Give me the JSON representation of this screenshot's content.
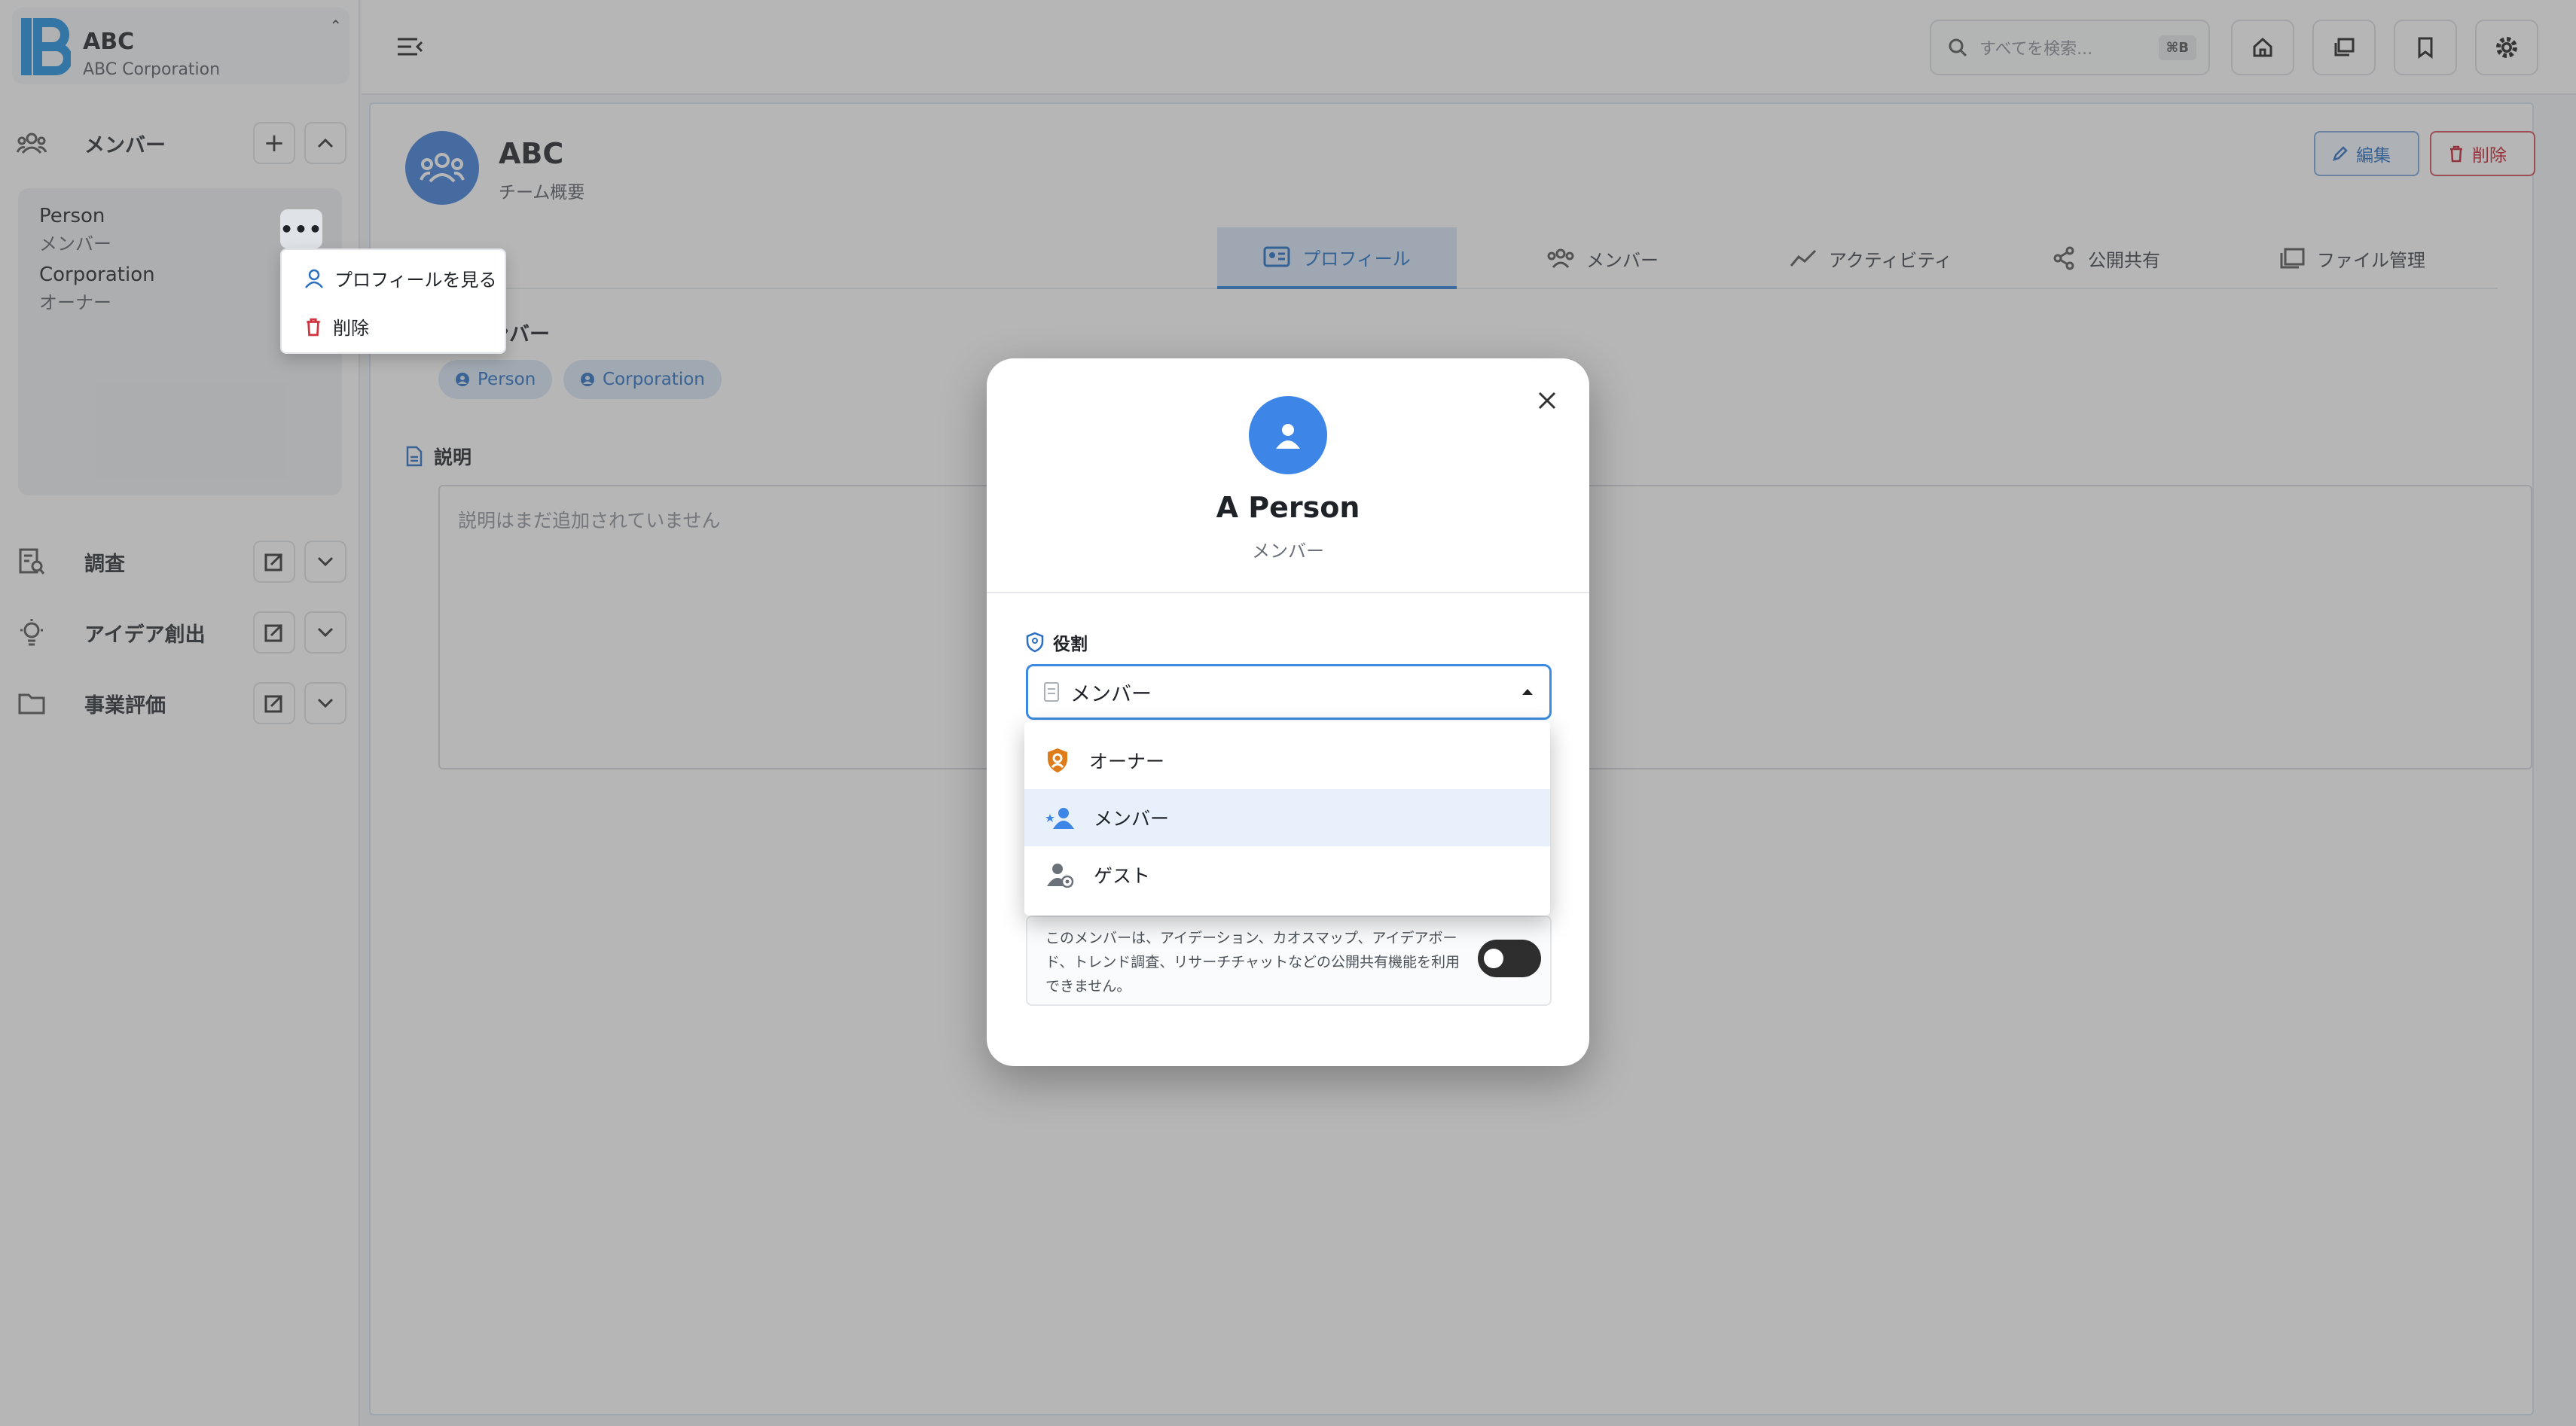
{
  "brand": {
    "name": "ABC",
    "subtitle": "ABC Corporation",
    "collapse_glyph": "⌃"
  },
  "sidebar": {
    "members_section": {
      "label": "メンバー",
      "add_glyph": "+",
      "members": [
        {
          "name": "Person",
          "role": "メンバー"
        },
        {
          "name": "Corporation",
          "role": "オーナー"
        }
      ]
    },
    "more_glyph": "•••",
    "context_menu": {
      "view_profile": "プロフィールを見る",
      "delete": "削除"
    },
    "sections": [
      {
        "label": "調査"
      },
      {
        "label": "アイデア創出"
      },
      {
        "label": "事業評価"
      }
    ]
  },
  "topbar": {
    "search_placeholder": "すべてを検索...",
    "search_shortcut": "⌘B"
  },
  "team": {
    "name": "ABC",
    "subtitle": "チーム概要",
    "edit_label": "編集",
    "delete_label": "削除",
    "tabs": [
      {
        "label": "プロフィール",
        "icon": "profile-card-icon"
      },
      {
        "label": "メンバー",
        "icon": "group-icon"
      },
      {
        "label": "アクティビティ",
        "icon": "trend-icon"
      },
      {
        "label": "公開共有",
        "icon": "share-icon"
      },
      {
        "label": "ファイル管理",
        "icon": "files-icon"
      }
    ],
    "members_label": "メンバー",
    "member_chips": [
      "Person",
      "Corporation"
    ],
    "description_label": "説明",
    "description_placeholder": "説明はまだ追加されていません"
  },
  "modal": {
    "name": "A Person",
    "role_subtitle": "メンバー",
    "role_label": "役割",
    "selected_role": "メンバー",
    "role_options": [
      {
        "label": "オーナー",
        "icon": "owner-shield-icon",
        "color": "#e07b1a"
      },
      {
        "label": "メンバー",
        "icon": "member-star-icon",
        "color": "#3d86e8"
      },
      {
        "label": "ゲスト",
        "icon": "guest-icon",
        "color": "#6b7178"
      }
    ],
    "permission_text": "このメンバーは、アイデーション、カオスマップ、アイデアボード、トレンド調査、リサーチチャットなどの公開共有機能を利用できません。",
    "permission_toggle": "off"
  },
  "colors": {
    "accent": "#3d86e8",
    "danger": "#c21f2e",
    "owner": "#e07b1a"
  }
}
